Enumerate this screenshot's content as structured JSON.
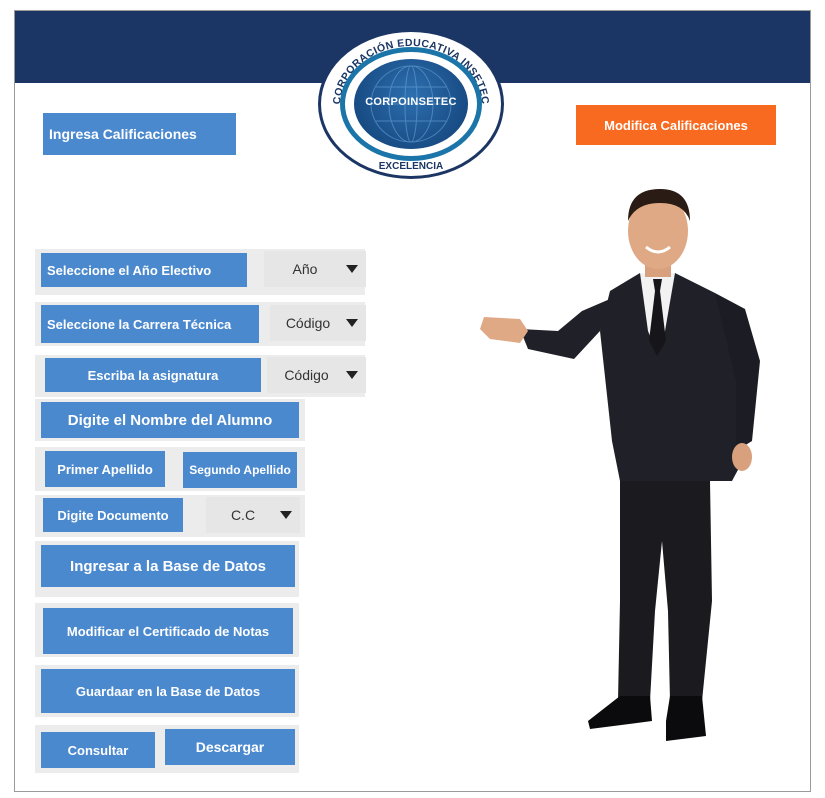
{
  "header": {
    "ingresa_label": "Ingresa Calificaciones",
    "modifica_label": "Modifica Calificaciones"
  },
  "logo": {
    "arc_text": "CORPORACIÓN EDUCATIVA INSETEC",
    "center_text": "CORPOINSETEC",
    "bottom_text": "EXCELENCIA"
  },
  "form": {
    "anio_label": "Seleccione el Año Electivo",
    "anio_value": "Año",
    "carrera_label": "Seleccione la Carrera Técnica",
    "carrera_value": "Código",
    "asignatura_label": "Escriba la asignatura",
    "asignatura_value": "Código",
    "nombre_label": "Digite el Nombre del Alumno",
    "primer_apellido_label": "Primer Apellido",
    "segundo_apellido_label": "Segundo Apellido",
    "documento_label": "Digite Documento",
    "documento_value": "C.C",
    "ingresar_label": "Ingresar a la Base de Datos",
    "modificar_label": "Modificar el Certificado de Notas",
    "guardar_label": "Guardaar en la Base de Datos",
    "consultar_label": "Consultar",
    "descargar_label": "Descargar"
  },
  "colors": {
    "header_bar": "#1b3664",
    "button_blue": "#4b89cf",
    "button_orange": "#f76a1f"
  }
}
